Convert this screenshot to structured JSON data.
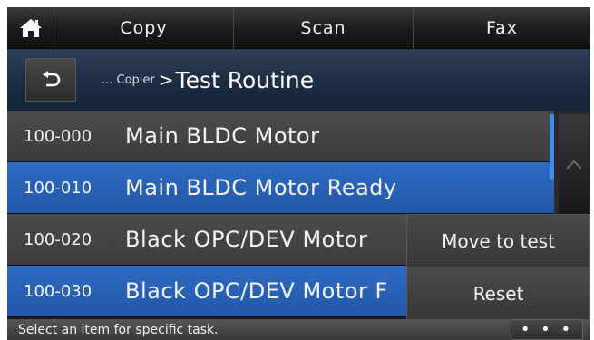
{
  "nav": {
    "home_icon": "home-icon",
    "tabs": [
      "Copy",
      "Scan",
      "Fax"
    ]
  },
  "breadcrumb": {
    "back_icon": "back-arrow-icon",
    "prefix": "... Copier",
    "separator": ">",
    "current": "Test Routine"
  },
  "list": {
    "items": [
      {
        "code": "100-000",
        "name": "Main BLDC Motor",
        "selected": false
      },
      {
        "code": "100-010",
        "name": "Main BLDC Motor Ready",
        "selected": true
      },
      {
        "code": "100-020",
        "name": "Black OPC/DEV Motor",
        "selected": false
      },
      {
        "code": "100-030",
        "name": "Black OPC/DEV Motor F",
        "selected": true
      }
    ],
    "scroll_up_icon": "chevron-up-icon"
  },
  "popup": {
    "items": [
      "Move to test",
      "Reset"
    ]
  },
  "status": {
    "text": "Select an item for specific task.",
    "more_label": "• • •"
  },
  "colors": {
    "selected_row": "#2a62b8",
    "row": "#444444",
    "header_blue": "#1f3048"
  }
}
